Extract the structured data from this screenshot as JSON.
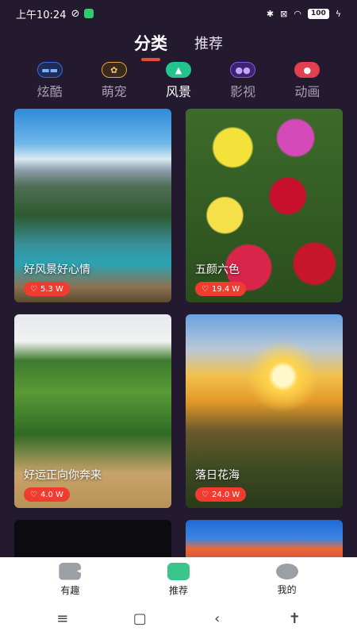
{
  "status": {
    "time": "上午10:24",
    "battery": "100"
  },
  "top_tabs": [
    {
      "label": "分类",
      "active": true
    },
    {
      "label": "推荐",
      "active": false
    }
  ],
  "categories": [
    {
      "label": "炫酷",
      "icon": "sunglasses-icon",
      "glyph": "▬▬"
    },
    {
      "label": "萌宠",
      "icon": "paw-icon",
      "glyph": "✿"
    },
    {
      "label": "风景",
      "icon": "landscape-icon",
      "glyph": "▲"
    },
    {
      "label": "影视",
      "icon": "film-icon",
      "glyph": "●●"
    },
    {
      "label": "动画",
      "icon": "mickey-icon",
      "glyph": "●"
    }
  ],
  "active_category": "风景",
  "cards": [
    {
      "title": "好风景好心情",
      "likes": "5.3 W"
    },
    {
      "title": "五颜六色",
      "likes": "19.4 W"
    },
    {
      "title": "好运正向你奔来",
      "likes": "4.0 W"
    },
    {
      "title": "落日花海",
      "likes": "24.0 W"
    },
    {
      "title": "",
      "likes": ""
    },
    {
      "title": "",
      "likes": ""
    }
  ],
  "bottom_nav": [
    {
      "label": "有趣",
      "icon": "fun-icon"
    },
    {
      "label": "推荐",
      "icon": "recommend-icon"
    },
    {
      "label": "我的",
      "icon": "mine-icon"
    }
  ],
  "colors": {
    "background": "#241a30",
    "accent": "#e84a36",
    "like_badge": "#f03c2e",
    "nav_active": "#3ac58a"
  }
}
